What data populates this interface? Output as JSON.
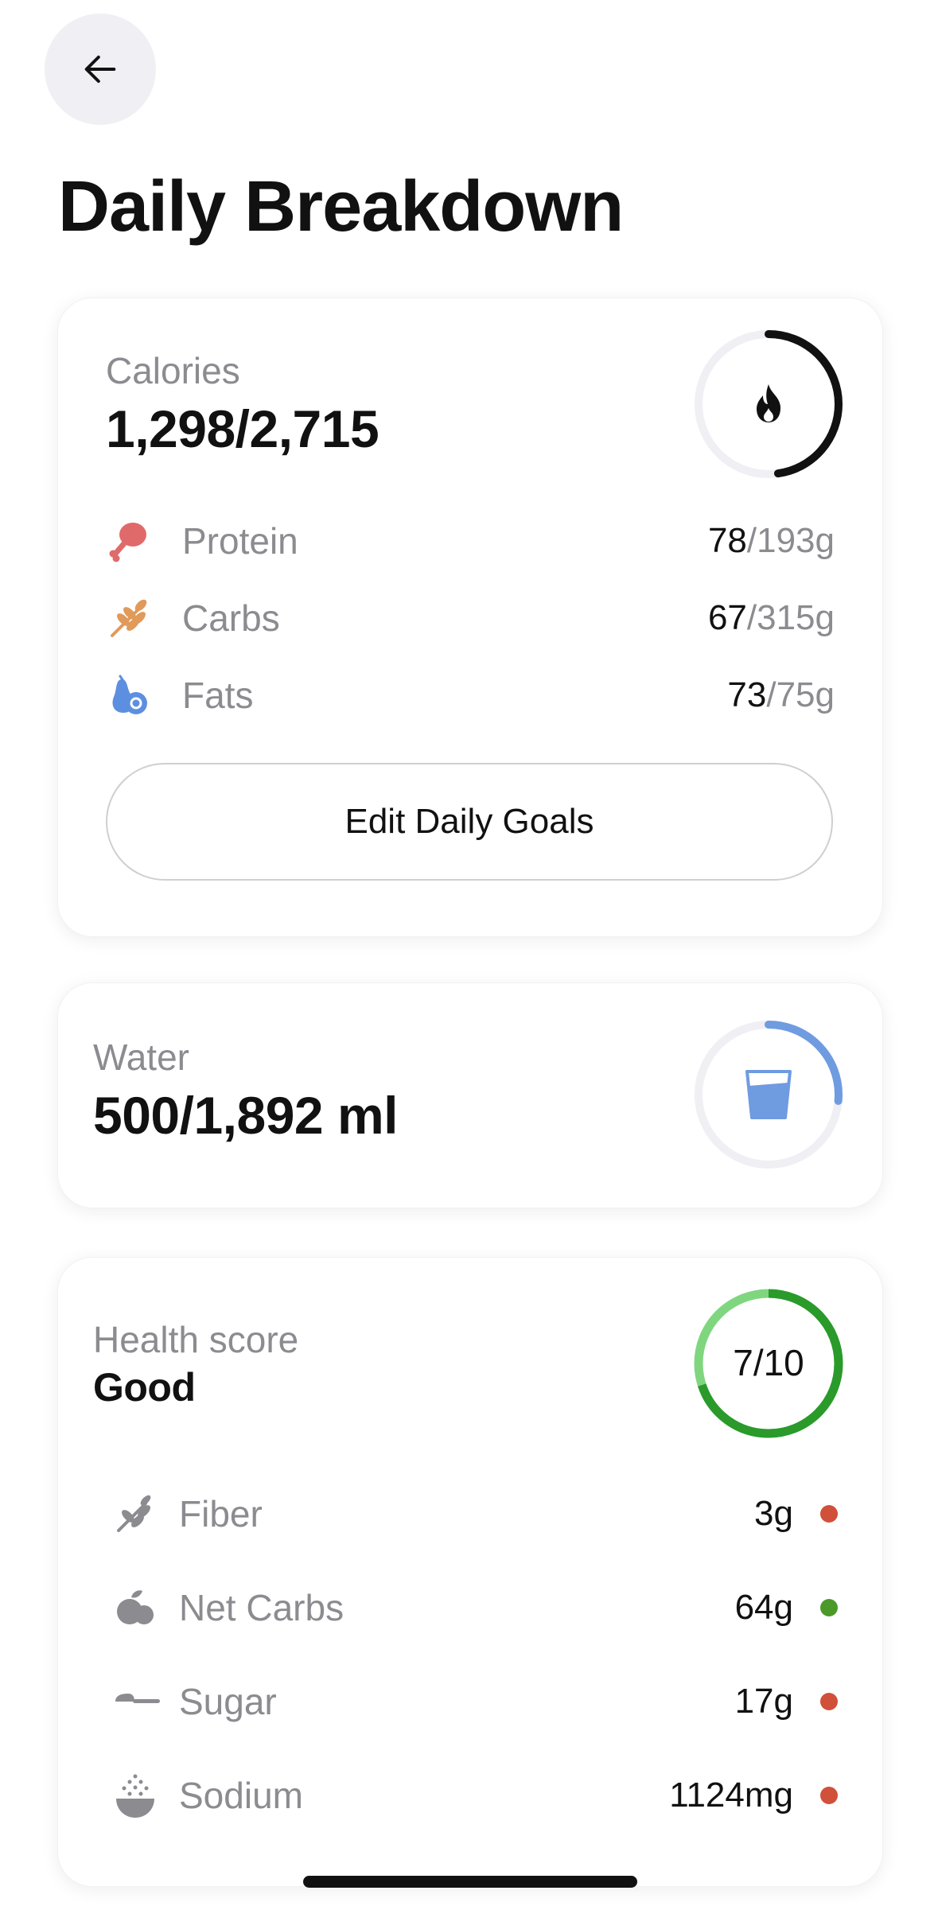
{
  "header": {
    "title": "Daily Breakdown",
    "back_icon": "arrow-left-icon"
  },
  "calories": {
    "label": "Calories",
    "consumed": 1298,
    "goal": 2715,
    "value_text": "1,298/2,715",
    "ring_color": "#111111",
    "ring_track": "#efeff4",
    "icon": "flame-icon",
    "macros": [
      {
        "name": "Protein",
        "value": "78",
        "goal": "/193g",
        "icon": "drumstick-icon",
        "color": "#e06a6a"
      },
      {
        "name": "Carbs",
        "value": "67",
        "goal": "/315g",
        "icon": "wheat-icon",
        "color": "#e09a5a"
      },
      {
        "name": "Fats",
        "value": "73",
        "goal": "/75g",
        "icon": "avocado-icon",
        "color": "#5d8fe0"
      }
    ],
    "edit_button": "Edit Daily Goals"
  },
  "water": {
    "label": "Water",
    "consumed": 500,
    "goal": 1892,
    "value_text": "500/1,892 ml",
    "ring_color": "#6f9be0",
    "icon": "water-glass-icon"
  },
  "health": {
    "label": "Health score",
    "rating": "Good",
    "score": 7,
    "max": 10,
    "score_text": "7/10",
    "ring_color": "#2a9a2a",
    "ring_light": "#7fd67f",
    "items": [
      {
        "name": "Fiber",
        "value": "3g",
        "icon": "leaf-icon",
        "status_color": "#d0503a"
      },
      {
        "name": "Net Carbs",
        "value": "64g",
        "icon": "fruit-icon",
        "status_color": "#4a9a2a"
      },
      {
        "name": "Sugar",
        "value": "17g",
        "icon": "spoon-icon",
        "status_color": "#d0503a"
      },
      {
        "name": "Sodium",
        "value": "1124mg",
        "icon": "salt-bowl-icon",
        "status_color": "#d0503a"
      }
    ]
  }
}
